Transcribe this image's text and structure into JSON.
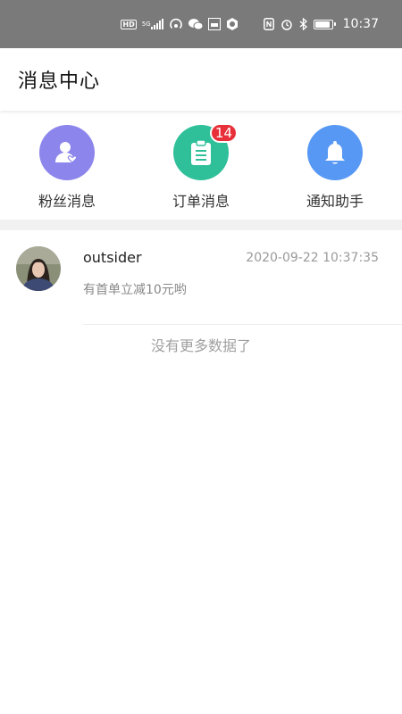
{
  "status_bar": {
    "network_label": "HD",
    "network_gen": "5G",
    "time": "10:37"
  },
  "header": {
    "title": "消息中心"
  },
  "quick_entries": [
    {
      "label": "粉丝消息",
      "icon": "fan-user-heart-icon",
      "color": "#8c85ec",
      "badge": ""
    },
    {
      "label": "订单消息",
      "icon": "clipboard-icon",
      "color": "#2fc09a",
      "badge": "14"
    },
    {
      "label": "通知助手",
      "icon": "bell-icon",
      "color": "#5898f5",
      "badge": ""
    }
  ],
  "messages": [
    {
      "name": "outsider",
      "time": "2020-09-22 10:37:35",
      "preview": "有首单立减10元哟"
    }
  ],
  "list_footer": "没有更多数据了",
  "colors": {
    "status_bar_bg": "#7a7a7a",
    "badge_red": "#e8303a",
    "divider": "#f1f1f1"
  }
}
